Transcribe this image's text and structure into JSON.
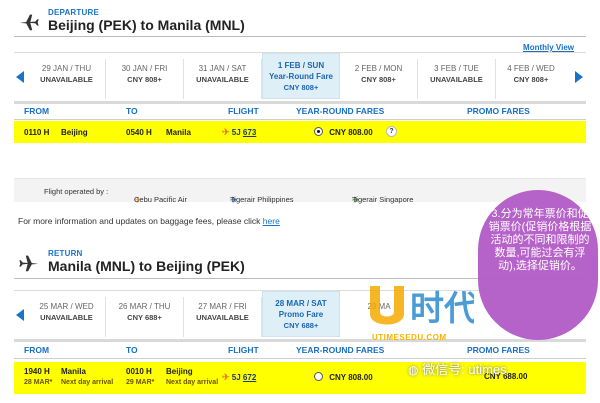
{
  "departure": {
    "kicker": "DEPARTURE",
    "route": "Beijing (PEK) to Manila (MNL)",
    "monthly_view": "Monthly View",
    "dates": [
      {
        "day": "29 JAN / THU",
        "info": "UNAVAILABLE"
      },
      {
        "day": "30 JAN / FRI",
        "info": "CNY 808+"
      },
      {
        "day": "31 JAN / SAT",
        "info": "UNAVAILABLE"
      },
      {
        "day": "1 FEB / SUN",
        "fare": "Year-Round Fare",
        "info": "CNY 808+"
      },
      {
        "day": "2 FEB / MON",
        "info": "CNY 808+"
      },
      {
        "day": "3 FEB / TUE",
        "info": "UNAVAILABLE"
      },
      {
        "day": "4 FEB / WED",
        "info": "CNY 808+"
      }
    ],
    "headers": {
      "from": "FROM",
      "to": "TO",
      "flight": "FLIGHT",
      "yearround": "YEAR-ROUND FARES",
      "promo": "PROMO FARES"
    },
    "flight": {
      "dep_time": "0110 H",
      "dep_city": "Beijing",
      "arr_time": "0540 H",
      "arr_city": "Manila",
      "carrier": "5J",
      "number": "673",
      "fare": "CNY  808.00",
      "help": "?"
    }
  },
  "legend": {
    "label": "Flight operated by :",
    "airlines": [
      "Cebu Pacific Air",
      "Tigerair Philippines",
      "Tigerair Singapore"
    ]
  },
  "baggage": {
    "text": "For more information and updates on baggage fees, please click",
    "link": "here"
  },
  "return": {
    "kicker": "RETURN",
    "route": "Manila (MNL) to Beijing (PEK)",
    "dates": [
      {
        "day": "25 MAR / WED",
        "info": "UNAVAILABLE"
      },
      {
        "day": "26 MAR / THU",
        "info": "CNY 688+"
      },
      {
        "day": "27 MAR / FRI",
        "info": "UNAVAILABLE"
      },
      {
        "day": "28 MAR / SAT",
        "fare": "Promo Fare",
        "info": "CNY  688+"
      },
      {
        "day": "29 MA"
      }
    ],
    "headers": {
      "from": "FROM",
      "to": "TO",
      "flight": "FLIGHT",
      "yearround": "YEAR-ROUND FARES",
      "promo": "PROMO FARES"
    },
    "flight": {
      "dep_time": "1940 H",
      "dep_city": "Manila",
      "dep_date": "28 MAR*",
      "dep_note": "Next day arrival",
      "arr_time": "0010 H",
      "arr_city": "Beijing",
      "arr_date": "29 MAR*",
      "arr_note": "Next day arrival",
      "carrier": "5J",
      "number": "672",
      "fare": "CNY  808.00",
      "promo_fare": "CNY  688.00"
    }
  },
  "overlay": {
    "note": "3.分为常年票价和促销票价(促销价格根据活动的不同和限制的数量,可能过会有浮动),选择促销价。",
    "logo": "U时代",
    "url": "UTIMESEDU.COM",
    "wechat": "微信号: utimes"
  },
  "colors": {
    "accent": "#1a73c8",
    "highlight": "#ffff00",
    "selected": "#dfeff8",
    "bubble": "#b25bc6"
  }
}
